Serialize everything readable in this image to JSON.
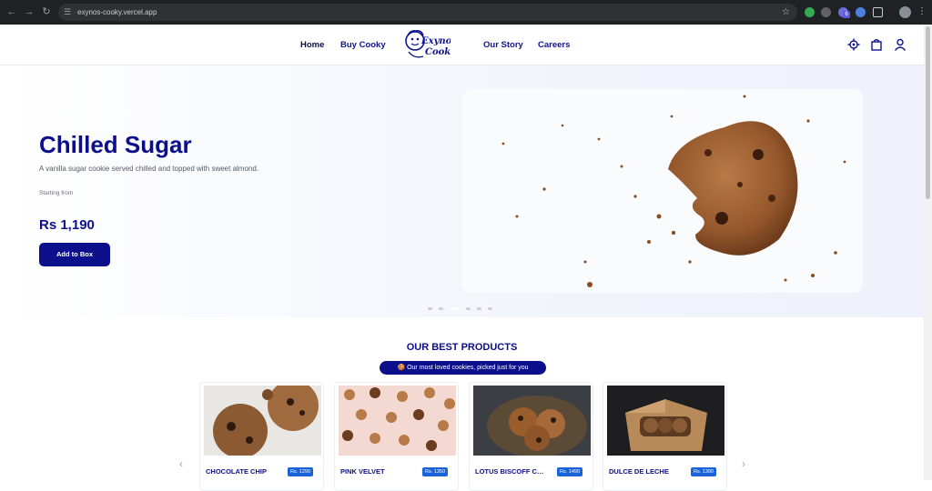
{
  "browser": {
    "url": "exynos-cooky.vercel.app",
    "extension_badge": "6"
  },
  "header": {
    "nav": {
      "home": "Home",
      "buy": "Buy Cooky",
      "story": "Our Story",
      "careers": "Careers"
    },
    "logo_text_1": "Exynos",
    "logo_text_2": "Cooky",
    "icons": [
      "location-icon",
      "bag-icon",
      "user-icon"
    ]
  },
  "hero": {
    "title": "Chilled Sugar",
    "description": "A vanilla sugar cookie served chilled and topped with sweet almond.",
    "starting_from": "Starting from",
    "price": "Rs 1,190",
    "button": "Add to Box",
    "slide_count": 6,
    "active_slide": 3
  },
  "best": {
    "title": "OUR BEST PRODUCTS",
    "subtitle": "🍪 Our most loved cookies, picked just for you",
    "products": [
      {
        "name": "CHOCOLATE CHIP",
        "price": "Rs. 1290"
      },
      {
        "name": "PINK VELVET",
        "price": "Rs. 1350"
      },
      {
        "name": "LOTUS BISCOFF CRUMBLE",
        "price": "Rs. 1490"
      },
      {
        "name": "DULCE DE LECHE",
        "price": "Rs. 1390"
      }
    ]
  },
  "colors": {
    "brand": "#0b0f8c",
    "price_badge": "#1b63d8",
    "chrome": "#202124"
  }
}
